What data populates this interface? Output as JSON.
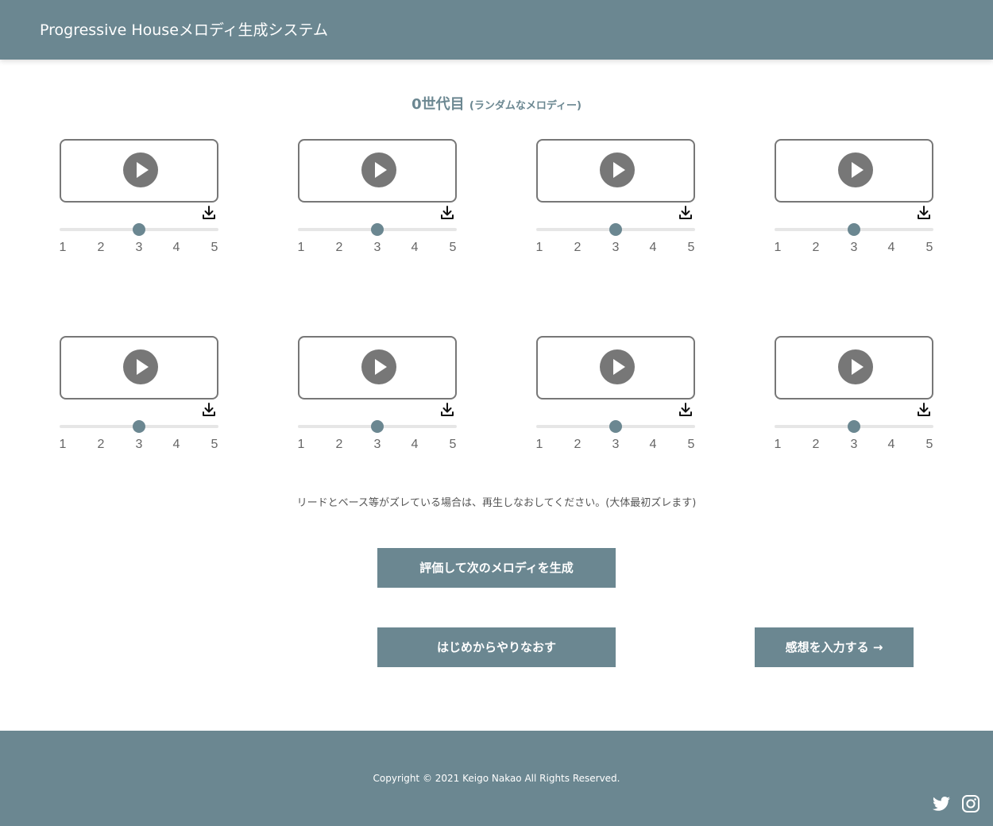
{
  "header": {
    "title": "Progressive Houseメロディ生成システム"
  },
  "generation": {
    "title": "0世代目",
    "subtitle": "(ランダムなメロディー)"
  },
  "rating_scale": [
    "1",
    "2",
    "3",
    "4",
    "5"
  ],
  "rating_default": 3,
  "melodies": [
    {
      "rating": 3
    },
    {
      "rating": 3
    },
    {
      "rating": 3
    },
    {
      "rating": 3
    },
    {
      "rating": 3
    },
    {
      "rating": 3
    },
    {
      "rating": 3
    },
    {
      "rating": 3
    }
  ],
  "note": "リードとベース等がズレている場合は、再生しなおしてください。(大体最初ズレます)",
  "buttons": {
    "evaluate": "評価して次のメロディを生成",
    "restart": "はじめからやりなおす",
    "feedback": "感想を入力する →"
  },
  "footer": {
    "copyright": "Copyright © 2021 Keigo Nakao All Rights Reserved."
  },
  "colors": {
    "accent": "#6b8791",
    "player_border": "#777777",
    "track": "#e6e6e6"
  },
  "icons": {
    "play": "play-icon",
    "download": "download-icon",
    "twitter": "twitter-icon",
    "instagram": "instagram-icon"
  }
}
